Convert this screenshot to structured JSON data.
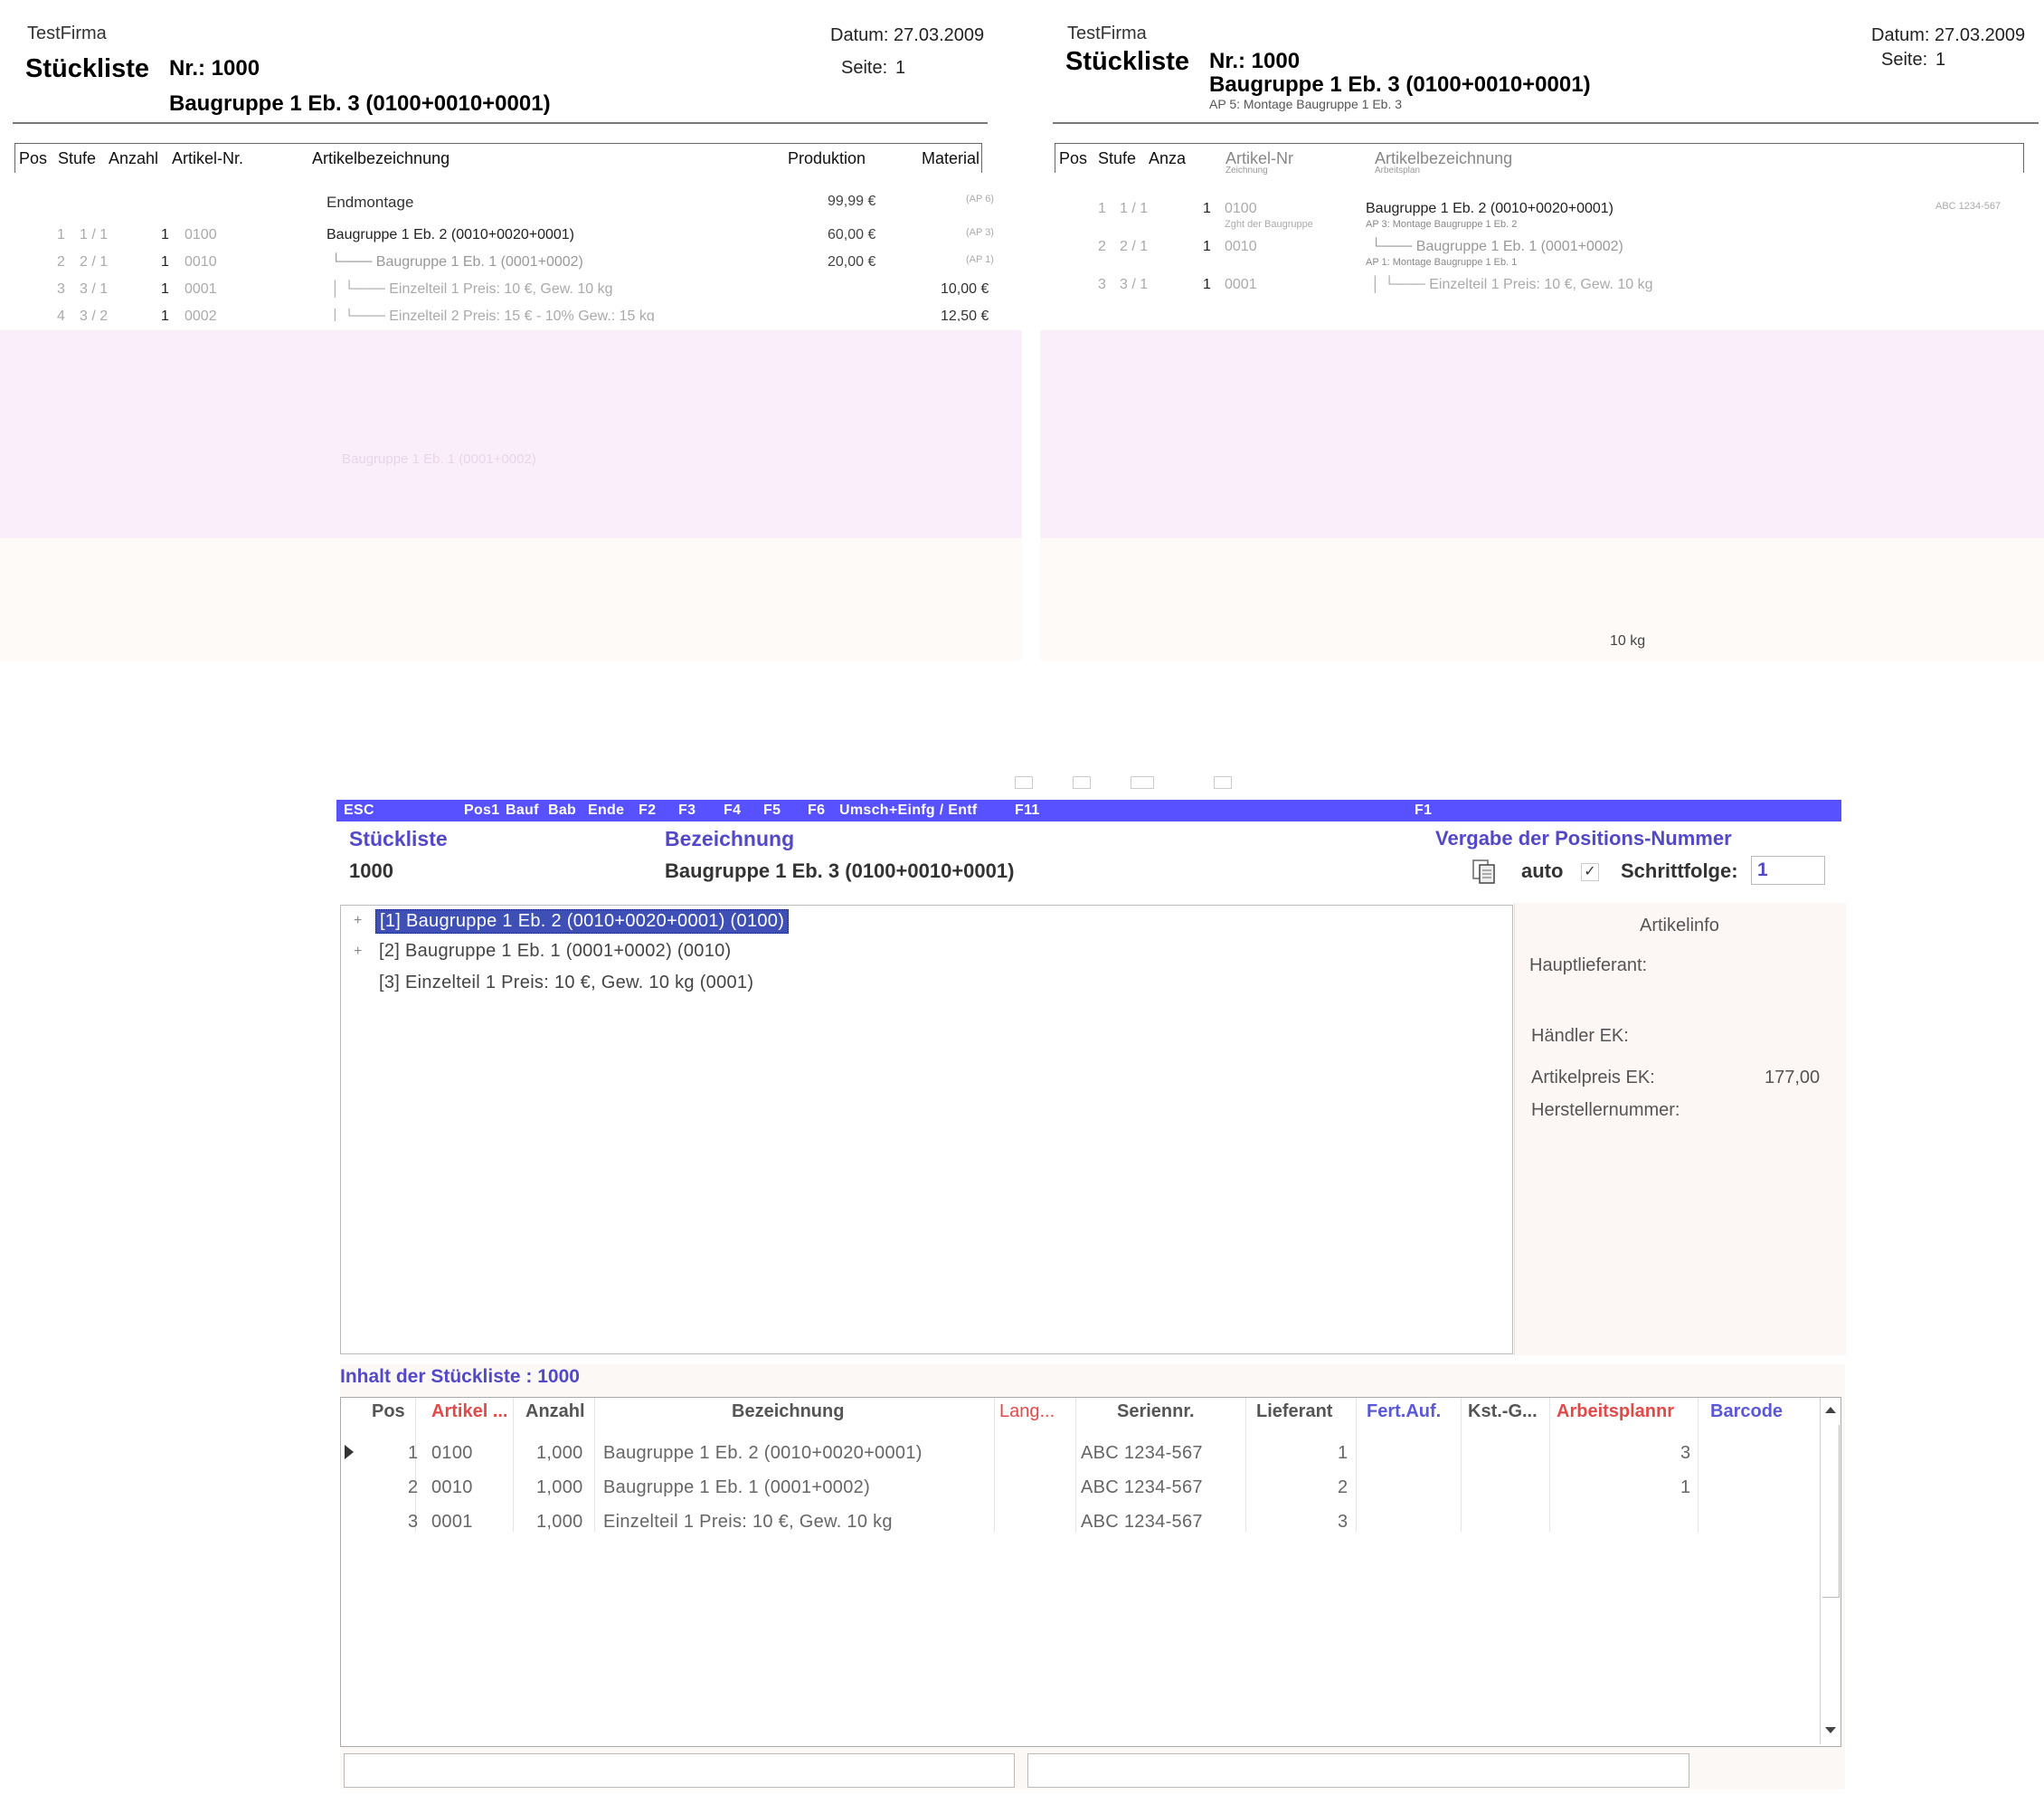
{
  "report_left": {
    "company": "TestFirma",
    "title": "Stückliste",
    "nr_label": "Nr.: 1000",
    "subtitle": "Baugruppe 1 Eb. 3 (0100+0010+0001)",
    "date": "Datum: 27.03.2009",
    "page_label": "Seite:",
    "page": "1",
    "columns": [
      "Pos",
      "Stufe",
      "Anzahl",
      "Artikel-Nr.",
      "Artikelbezeichnung",
      "Produktion",
      "Material"
    ],
    "rows": [
      {
        "pos": "",
        "stufe": "",
        "anzahl": "",
        "artikel": "",
        "bezeichnung": "Endmontage",
        "produktion": "99,99 €",
        "material": "(AP 6)"
      },
      {
        "pos": "1",
        "stufe": "1 /  1",
        "anzahl": "1",
        "artikel": "0100",
        "bezeichnung": "Baugruppe 1 Eb. 2 (0010+0020+0001)",
        "produktion": "60,00 €",
        "material": "(AP 3)"
      },
      {
        "pos": "2",
        "stufe": "2 /  1",
        "anzahl": "1",
        "artikel": "0010",
        "bezeichnung": "└─── Baugruppe 1 Eb. 1 (0001+0002)",
        "produktion": "20,00 €",
        "material": "(AP 1)"
      },
      {
        "pos": "3",
        "stufe": "3 /  1",
        "anzahl": "1",
        "artikel": "0001",
        "bezeichnung": "│      └─── Einzelteil 1 Preis: 10 €, Gew. 10 kg",
        "produktion": "",
        "material": "10,00 €"
      },
      {
        "pos": "4",
        "stufe": "3 /  2",
        "anzahl": "1",
        "artikel": "0002",
        "bezeichnung": "│      └─── Einzelteil 2 Preis: 15 € - 10% Gew.: 15 kg",
        "produktion": "",
        "material": "12,50 €"
      }
    ],
    "faded_label": "Baugruppe 1 Eb. 1 (0001+0002)"
  },
  "report_right": {
    "company": "TestFirma",
    "title": "Stückliste",
    "nr_label": "Nr.: 1000",
    "subtitle": "Baugruppe 1 Eb. 3 (0100+0010+0001)",
    "subtitle_note": "AP 5: Montage Baugruppe 1 Eb. 3",
    "date": "Datum: 27.03.2009",
    "page_label": "Seite:",
    "page": "1",
    "columns": [
      "Pos",
      "Stufe",
      "Anza",
      "Artikel-Nr",
      "Artikelbezeichnung"
    ],
    "col_sub": [
      "Zeichnung",
      "Arbeitsplan"
    ],
    "rows": [
      {
        "pos": "1",
        "stufe": "1 /  1",
        "anzahl": "1",
        "artikel": "0100",
        "note": "Zght der Baugruppe",
        "bezeichnung": "Baugruppe 1 Eb. 2 (0010+0020+0001)",
        "sub": "AP 3: Montage Baugruppe 1 Eb. 2",
        "right": "ABC 1234-567"
      },
      {
        "pos": "2",
        "stufe": "2 /  1",
        "anzahl": "1",
        "artikel": "0010",
        "note": "",
        "bezeichnung": "└─── Baugruppe 1 Eb. 1 (0001+0002)",
        "sub": "AP 1: Montage Baugruppe 1 Eb. 1",
        "right": ""
      },
      {
        "pos": "3",
        "stufe": "3 /  1",
        "anzahl": "1",
        "artikel": "0001",
        "note": "",
        "bezeichnung": "│      └─── Einzelteil 1 Preis: 10 €, Gew. 10 kg",
        "sub": "",
        "right": ""
      }
    ],
    "weight_fragment": "10 kg"
  },
  "app": {
    "fkeys": [
      "ESC",
      "Pos1",
      "Bauf",
      "Bab",
      "Ende",
      "F2",
      "F3",
      "F4",
      "F5",
      "F6",
      "Umsch+Einfg / Entf",
      "F11",
      "F1"
    ],
    "stueckliste_label": "Stückliste",
    "stueckliste_value": "1000",
    "bezeichnung_label": "Bezeichnung",
    "bezeichnung_value": "Baugruppe 1 Eb. 3 (0100+0010+0001)",
    "vergabe_label": "Vergabe der Positions-Nummer",
    "auto_label": "auto",
    "auto_checked": "✓",
    "schrittfolge_label": "Schrittfolge:",
    "schrittfolge_value": "1",
    "tree": [
      {
        "label": "[1] Baugruppe 1 Eb. 2 (0010+0020+0001) (0100)",
        "expander": "+",
        "selected": true
      },
      {
        "label": "[2] Baugruppe 1 Eb. 1 (0001+0002) (0010)",
        "expander": "+",
        "selected": false
      },
      {
        "label": "[3] Einzelteil 1 Preis: 10 €, Gew. 10 kg (0001)",
        "expander": "",
        "selected": false
      }
    ],
    "artikelinfo": {
      "title": "Artikelinfo",
      "hauptlieferant": "Hauptlieferant:",
      "haendler_ek": "Händler EK:",
      "artikelpreis_ek": "Artikelpreis EK:",
      "artikelpreis_value": "177,00",
      "herstellernummer": "Herstellernummer:"
    },
    "inhalt_label": "Inhalt der Stückliste : 1000",
    "grid": {
      "headers": [
        "Pos",
        "Artikel ...",
        "Anzahl",
        "Bezeichnung",
        "Lang...",
        "Seriennr.",
        "Lieferant",
        "Fert.Auf.",
        "Kst.-G...",
        "Arbeitsplannr",
        "Barcode"
      ],
      "rows": [
        {
          "pos": "1",
          "artikel": "0100",
          "anzahl": "1,000",
          "bezeichnung": "Baugruppe 1 Eb. 2 (0010+0020+0001)",
          "seriennr": "ABC 1234-567",
          "lieferant": "1",
          "arbeitsplan": "3"
        },
        {
          "pos": "2",
          "artikel": "0010",
          "anzahl": "1,000",
          "bezeichnung": "Baugruppe 1 Eb. 1 (0001+0002)",
          "seriennr": "ABC 1234-567",
          "lieferant": "2",
          "arbeitsplan": "1"
        },
        {
          "pos": "3",
          "artikel": "0001",
          "anzahl": "1,000",
          "bezeichnung": "Einzelteil 1 Preis: 10 €, Gew. 10 kg",
          "seriennr": "ABC 1234-567",
          "lieferant": "3",
          "arbeitsplan": ""
        }
      ]
    },
    "colors": {
      "fkey_bar": "#5751ff",
      "label_blue": "#5349c8",
      "header_red": "#e24a4a",
      "selection": "#3e4fb5"
    }
  }
}
